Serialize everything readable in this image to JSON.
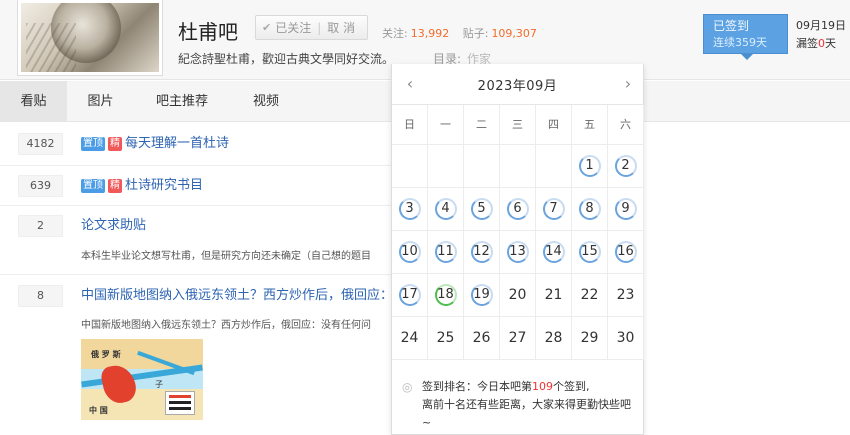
{
  "header": {
    "forum_name": "杜甫吧",
    "follow": {
      "followed_label": "已关注",
      "cancel_label": "取 消"
    },
    "stats": {
      "follow_label": "关注:",
      "follow_count": "13,992",
      "post_label": "贴子:",
      "post_count": "109,307"
    },
    "slogan": "紀念詩聖杜甫，歡迎古典文學同好交流。",
    "catalog": {
      "label": "目录:",
      "value": "作家"
    }
  },
  "sign": {
    "signed_label": "已签到",
    "streak_prefix": "连续",
    "streak_days": "359",
    "streak_suffix": "天",
    "date": "09月19日",
    "missed_prefix": "漏签",
    "missed_days": "0",
    "missed_suffix": "天"
  },
  "nav": {
    "tabs": [
      "看贴",
      "图片",
      "吧主推荐",
      "视频"
    ],
    "active": 0
  },
  "threads": [
    {
      "replies": "4182",
      "badges": [
        "置顶",
        "精"
      ],
      "title": "每天理解一首杜诗",
      "abstract": ""
    },
    {
      "replies": "639",
      "badges": [
        "置顶",
        "精"
      ],
      "title": "杜诗研究书目",
      "abstract": ""
    },
    {
      "replies": "2",
      "badges": [],
      "title": "论文求助贴",
      "abstract": "本科生毕业论文想写杜甫，但是研究方向还未确定（自己想的题目"
    },
    {
      "replies": "8",
      "badges": [],
      "title": "中国新版地图纳入俄远东领土？西方炒作后，俄回应：没",
      "abstract": "中国新版地图纳入俄远东领土？西方炒作后，俄回应：没有任何问"
    }
  ],
  "map_labels": {
    "russia": "俄 罗 斯",
    "china": "中 国",
    "zi": "子"
  },
  "calendar": {
    "title": "2023年09月",
    "prev_icon": "chevron-left-icon",
    "next_icon": "chevron-right-icon",
    "weekdays": [
      "日",
      "一",
      "二",
      "三",
      "四",
      "五",
      "六"
    ],
    "days": [
      "1",
      "2",
      "3",
      "4",
      "5",
      "6",
      "7",
      "8",
      "9",
      "10",
      "11",
      "12",
      "13",
      "14",
      "15",
      "16",
      "17",
      "18",
      "19",
      "20",
      "21",
      "22",
      "23",
      "24",
      "25",
      "26",
      "27",
      "28",
      "29",
      "30"
    ],
    "first_weekday": 5,
    "signed_through": 19,
    "today": 18,
    "footer": {
      "prefix": "签到排名：今日本吧第",
      "rank": "109",
      "suffix": "个签到,",
      "line2": "离前十名还有些距离，大家来得更勤快些吧~"
    }
  },
  "colors": {
    "accent_blue": "#5ca2e3",
    "link_blue": "#2d64b3",
    "top_badge": "#4b9ce6",
    "good_badge": "#f0585a",
    "count_orange": "#f26c2c",
    "signed_ring": "#6aa3dd",
    "today_ring": "#4cbf4c"
  }
}
